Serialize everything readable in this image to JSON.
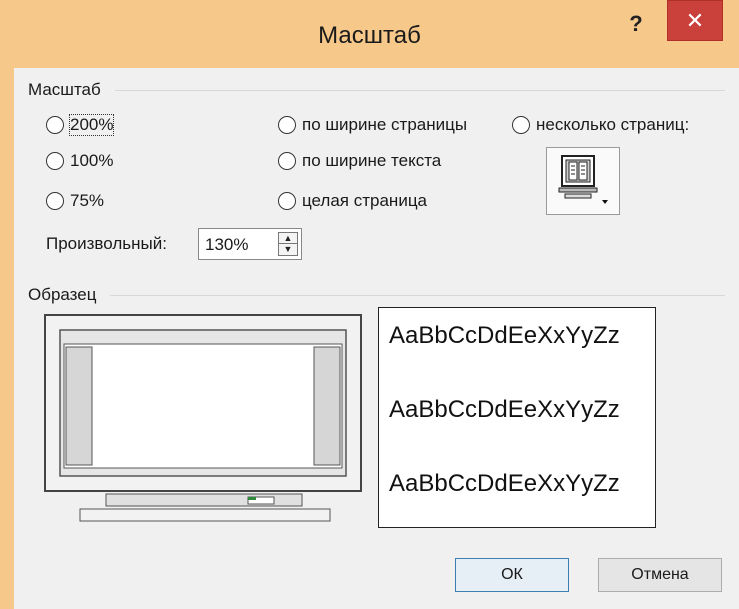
{
  "window": {
    "title": "Масштаб",
    "help_label": "?",
    "close_label": "✕"
  },
  "zoom_group": {
    "label": "Масштаб",
    "options": [
      {
        "label": "200%",
        "selected": false
      },
      {
        "label": "100%",
        "selected": false
      },
      {
        "label": "75%",
        "selected": false
      },
      {
        "label": "по ширине страницы",
        "selected": false
      },
      {
        "label": "по ширине текста",
        "selected": false
      },
      {
        "label": "целая страница",
        "selected": false
      },
      {
        "label": "несколько страниц:",
        "selected": false
      }
    ],
    "custom_label": "Произвольный:",
    "custom_value": "130%",
    "pages_button_icon": "monitor-pages-icon"
  },
  "preview_group": {
    "label": "Образец",
    "sample_lines": [
      "AaBbCcDdEeXxYyZz",
      "AaBbCcDdEeXxYyZz",
      "AaBbCcDdEeXxYyZz"
    ],
    "monitor_icon": "monitor-preview-icon"
  },
  "buttons": {
    "ok_label": "ОК",
    "cancel_label": "Отмена"
  }
}
